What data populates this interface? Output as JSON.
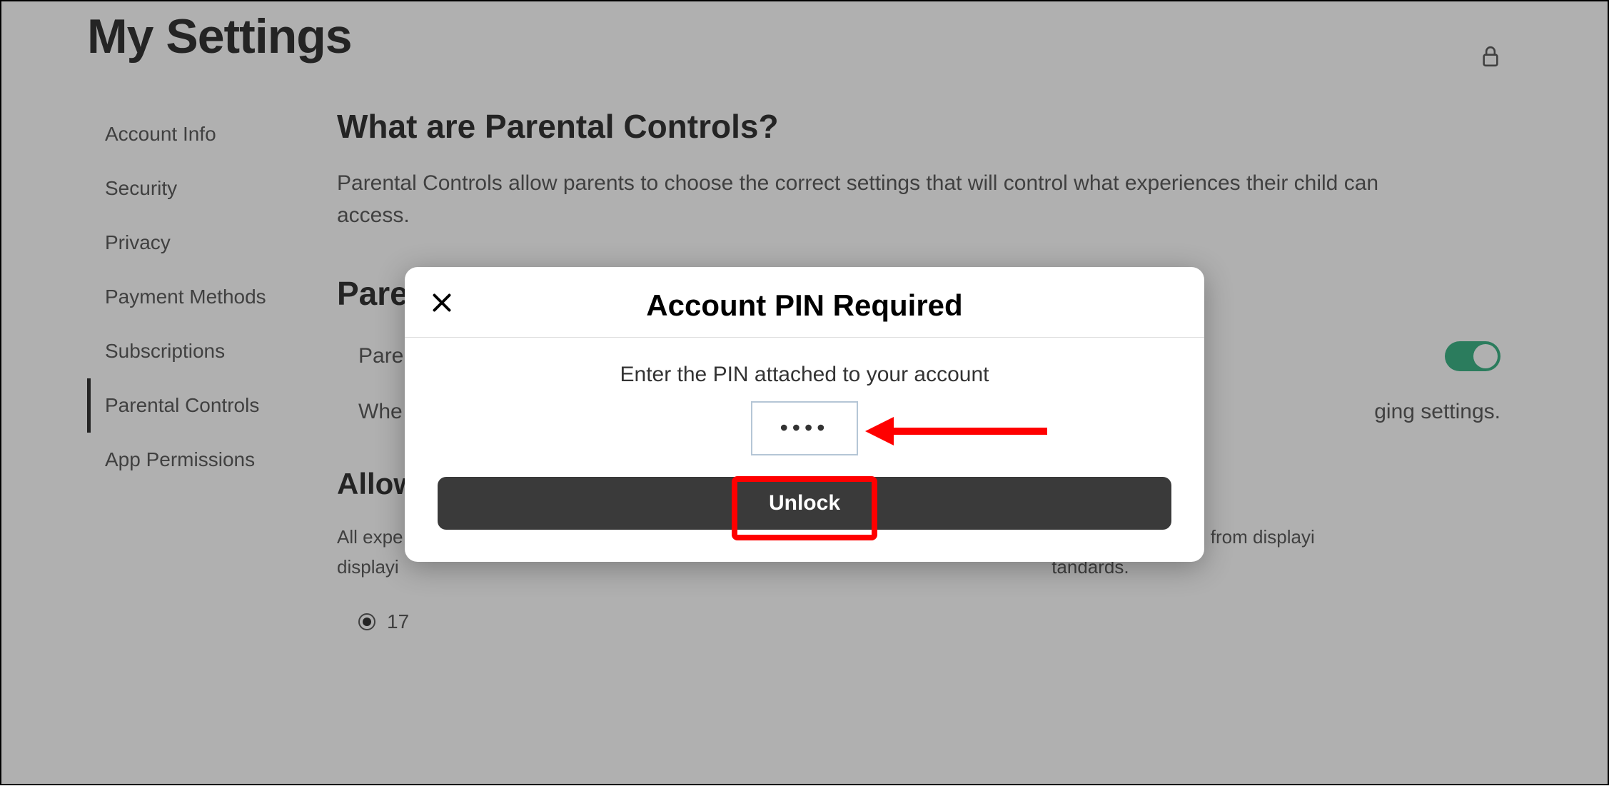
{
  "pageTitle": "My Settings",
  "sidebar": {
    "items": [
      {
        "label": "Account Info"
      },
      {
        "label": "Security"
      },
      {
        "label": "Privacy"
      },
      {
        "label": "Payment Methods"
      },
      {
        "label": "Subscriptions"
      },
      {
        "label": "Parental Controls"
      },
      {
        "label": "App Permissions"
      }
    ],
    "activeIndex": 5
  },
  "main": {
    "whatTitle": "What are Parental Controls?",
    "whatDesc": "Parental Controls allow parents to choose the correct settings that will control what experiences their child can access.",
    "pinTitle": "Parent PIN",
    "pinEnabledLabel": "Parent PIN is enabled",
    "pinToggleOn": true,
    "pinInfoPrefix": "Whe",
    "pinInfoSuffix": "ging settings.",
    "allowedTitle": "Allow",
    "ageDescPrefix": "All expe",
    "ageDescMiddle": "and are prohibited from displayi",
    "ageDescLink": "tandards",
    "ageDescEnd": ".",
    "radioLabel": "17"
  },
  "modal": {
    "title": "Account PIN Required",
    "instruction": "Enter the PIN attached to your account",
    "pinValue": "••••",
    "unlockLabel": "Unlock"
  }
}
